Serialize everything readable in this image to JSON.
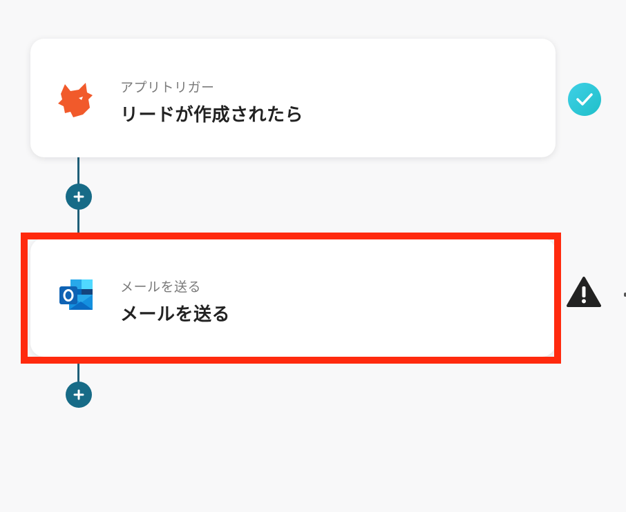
{
  "flow": {
    "steps": [
      {
        "app": "yoom-fox",
        "subtitle": "アプリトリガー",
        "title": "リードが作成されたら",
        "status": "complete",
        "status_icon": "check-circle-icon"
      },
      {
        "app": "outlook",
        "subtitle": "メールを送る",
        "title": "メールを送る",
        "status": "warning",
        "status_icon": "warning-triangle-icon",
        "highlighted": true
      }
    ],
    "add_step_icon": "plus-icon"
  },
  "colors": {
    "background": "#f8f8f9",
    "connector": "#176b87",
    "check": "#27c7d6",
    "warning": "#222222",
    "highlight": "#ff2a0e",
    "fox": "#f15a2b"
  }
}
